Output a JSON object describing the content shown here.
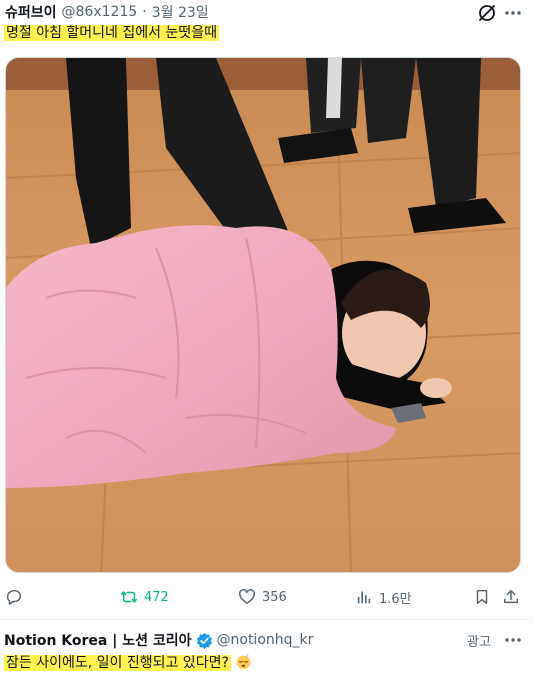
{
  "tweet": {
    "author_name": "슈퍼브이",
    "handle": "@86x1215",
    "separator": "·",
    "date": "3월 23일",
    "text": "명절 아침 할머니네 집에서 눈떳을때",
    "highlight_color": "#fff250",
    "media_icon": "photo",
    "actions": {
      "reply_icon": "reply-icon",
      "retweet_icon": "retweet-icon",
      "retweet_count": "472",
      "retweet_color": "#00ba7c",
      "like_icon": "heart-icon",
      "like_count": "356",
      "views_icon": "bar-chart-icon",
      "views_count": "1.6만",
      "bookmark_icon": "bookmark-icon",
      "share_icon": "share-icon"
    }
  },
  "ad": {
    "name": "Notion Korea | 노션 코리아",
    "verified_icon": "verified-badge-icon",
    "handle": "@notionhq_kr",
    "label": "광고",
    "text": "잠든 사이에도, 일이 진행되고 있다면?",
    "emoji_icon": "sleeping-face-icon"
  }
}
